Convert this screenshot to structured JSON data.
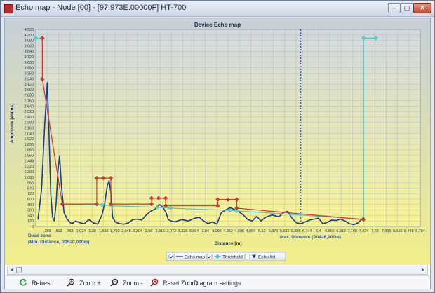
{
  "window": {
    "title": "Echo map - Node [00] - [97.973E.00000F] HT-700",
    "min_glyph": "–",
    "max_glyph": "▢",
    "close_glyph": "✕"
  },
  "toolbar": {
    "refresh": "Refresh",
    "zoom_in": "Zoom +",
    "zoom_out": "Zoom -",
    "reset_zoom": "Reset Zoom",
    "diagram_settings": "Diagram settings"
  },
  "scroll": {
    "left": "◄",
    "right": "►"
  },
  "chart_data": {
    "type": "line",
    "title": "Device Echo map",
    "xlabel": "Distance [m]",
    "ylabel": "Amplitude [400ns]",
    "xlim": [
      0,
      8.704
    ],
    "ylim": [
      0,
      4320
    ],
    "grid": true,
    "x_ticks": [
      0.256,
      0.512,
      0.768,
      1.024,
      1.28,
      1.536,
      1.792,
      2.048,
      2.304,
      2.56,
      2.816,
      3.072,
      3.328,
      3.584,
      3.84,
      4.096,
      4.352,
      4.608,
      4.864,
      5.12,
      5.376,
      5.632,
      5.888,
      6.144,
      6.4,
      6.656,
      6.912,
      7.168,
      7.424,
      7.68,
      7.936,
      8.192,
      8.448,
      8.704
    ],
    "x_tick_labels": [
      ",256",
      ",512",
      ",768",
      "1,024",
      "1,28",
      "1,536",
      "1,792",
      "2,048",
      "2,304",
      "2,56",
      "2,816",
      "3,072",
      "3,328",
      "3,584",
      "3,84",
      "4,096",
      "4,352",
      "4,608",
      "4,864",
      "5,12",
      "5,376",
      "5,632",
      "5,888",
      "6,144",
      "6,4",
      "6,656",
      "6,912",
      "7,168",
      "7,424",
      "7,68",
      "7,936",
      "8,192",
      "8,448",
      "8,704"
    ],
    "y_ticks": [
      0,
      120,
      240,
      360,
      480,
      600,
      720,
      840,
      960,
      1080,
      1200,
      1320,
      1440,
      1560,
      1680,
      1800,
      1920,
      2040,
      2160,
      2280,
      2400,
      2520,
      2640,
      2760,
      2880,
      3000,
      3120,
      3240,
      3360,
      3480,
      3600,
      3720,
      3840,
      3960,
      4080,
      4200,
      4320
    ],
    "y_tick_labels": [
      "0",
      "120",
      "240",
      "360",
      "480",
      "600",
      "720",
      "840",
      "960",
      "1 080",
      "1 200",
      "1 320",
      "1 440",
      "1 560",
      "1 680",
      "1 800",
      "1 920",
      "2 040",
      "2 160",
      "2 280",
      "2 400",
      "2 520",
      "2 640",
      "2 760",
      "2 880",
      "3 000",
      "3 120",
      "3 240",
      "3 360",
      "3 480",
      "3 600",
      "3 720",
      "3 840",
      "3 960",
      "4 080",
      "4 200",
      "4 320"
    ],
    "annotations": {
      "dead_zone_1": "Dead zone",
      "dead_zone_2": "(Min. Distance, P05=0,000m)",
      "max_distance": "Max. Distance (P04=6,000m)",
      "max_distance_x": 6.0
    },
    "legend": {
      "position": "bottom",
      "items": [
        "Echo map",
        "Threshold",
        "Echo list"
      ]
    },
    "series": [
      {
        "name": "Echo map",
        "color": "#1a3c8c",
        "x": [
          0.05,
          0.13,
          0.2,
          0.26,
          0.3,
          0.34,
          0.38,
          0.42,
          0.46,
          0.5,
          0.54,
          0.58,
          0.64,
          0.7,
          0.76,
          0.82,
          0.9,
          1.0,
          1.1,
          1.2,
          1.3,
          1.4,
          1.5,
          1.56,
          1.62,
          1.66,
          1.7,
          1.74,
          1.8,
          1.9,
          2.0,
          2.1,
          2.2,
          2.3,
          2.4,
          2.5,
          2.6,
          2.7,
          2.8,
          2.88,
          2.95,
          3.0,
          3.06,
          3.15,
          3.3,
          3.45,
          3.6,
          3.7,
          3.8,
          3.9,
          4.0,
          4.1,
          4.2,
          4.3,
          4.4,
          4.5,
          4.6,
          4.7,
          4.8,
          4.9,
          5.0,
          5.1,
          5.2,
          5.35,
          5.5,
          5.6,
          5.7,
          5.8,
          5.9,
          6.0,
          6.1,
          6.2,
          6.3,
          6.4,
          6.5,
          6.6,
          6.7,
          6.8,
          6.9,
          7.0,
          7.1,
          7.2,
          7.3,
          7.42
        ],
        "y": [
          150,
          800,
          2200,
          3150,
          2000,
          700,
          200,
          120,
          500,
          1200,
          1550,
          900,
          300,
          180,
          100,
          60,
          120,
          80,
          60,
          150,
          80,
          50,
          250,
          500,
          900,
          1000,
          750,
          200,
          100,
          60,
          50,
          80,
          150,
          160,
          140,
          250,
          330,
          380,
          480,
          420,
          300,
          150,
          120,
          100,
          150,
          120,
          180,
          200,
          120,
          60,
          100,
          50,
          300,
          360,
          410,
          370,
          320,
          250,
          150,
          120,
          220,
          120,
          200,
          250,
          210,
          300,
          330,
          180,
          80,
          60,
          100,
          140,
          160,
          180,
          60,
          90,
          140,
          130,
          160,
          120,
          60,
          40,
          80,
          200
        ]
      },
      {
        "name": "Threshold",
        "color": "#4fc4c8",
        "x": [
          0.0,
          0.15,
          0.15,
          0.15,
          0.6,
          1.5,
          1.72,
          2.75,
          3.05,
          4.4,
          4.55,
          7.42,
          7.42,
          7.42,
          7.7
        ],
        "y": [
          4130,
          4130,
          3230,
          3230,
          490,
          470,
          450,
          420,
          400,
          350,
          340,
          160,
          160,
          4130,
          4130
        ]
      },
      {
        "name": "Echo list",
        "color": "#d8372b",
        "x": [
          0.15,
          0.15,
          0.6,
          1.38,
          1.38,
          1.53,
          1.7,
          1.7,
          2.62,
          2.62,
          2.78,
          2.94,
          2.94,
          4.12,
          4.12,
          4.35,
          4.55,
          4.55,
          7.42
        ],
        "y": [
          4130,
          3230,
          490,
          490,
          1060,
          1060,
          1060,
          490,
          490,
          620,
          620,
          620,
          450,
          450,
          590,
          590,
          590,
          400,
          150
        ]
      }
    ]
  }
}
